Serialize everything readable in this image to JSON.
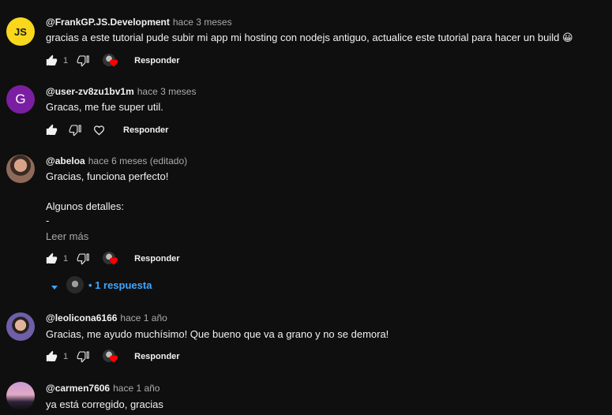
{
  "comments": [
    {
      "avatar_text": "JS",
      "handle": "@FrankGP.JS.Development",
      "time": "hace 3 meses",
      "lines": [
        "gracias a este tutorial pude subir mi app mi hosting con nodejs antiguo, actualice este tutorial para hacer un build 😀"
      ],
      "likes": "1",
      "reply_label": "Responder"
    },
    {
      "avatar_text": "G",
      "handle": "@user-zv8zu1bv1m",
      "time": "hace 3 meses",
      "lines": [
        "Gracas, me fue super util."
      ],
      "likes": "",
      "reply_label": "Responder"
    },
    {
      "avatar_text": "",
      "handle": "@abeloa",
      "time": "hace 6 meses (editado)",
      "lines": [
        "Gracias, funciona perfecto!",
        "",
        "Algunos detalles:",
        "-"
      ],
      "read_more": "Leer más",
      "likes": "1",
      "reply_label": "Responder",
      "replies_label": "• 1 respuesta"
    },
    {
      "avatar_text": "",
      "handle": "@leolicona6166",
      "time": "hace 1 año",
      "lines": [
        "Gracias,  me ayudo muchísimo!  Que bueno que va a grano y no se demora!"
      ],
      "likes": "1",
      "reply_label": "Responder"
    },
    {
      "avatar_text": "",
      "handle": "@carmen7606",
      "time": "hace 1 año",
      "lines": [
        "ya está corregido, gracias"
      ]
    }
  ],
  "colors": {
    "background": "#0f0f0f",
    "text": "#f1f1f1",
    "muted": "#aaaaaa",
    "link": "#3ea6ff",
    "heart": "#ff0000"
  },
  "icons": [
    "thumb-up-icon",
    "thumb-down-icon",
    "heart-icon",
    "creator-heart-icon",
    "caret-down-icon"
  ]
}
